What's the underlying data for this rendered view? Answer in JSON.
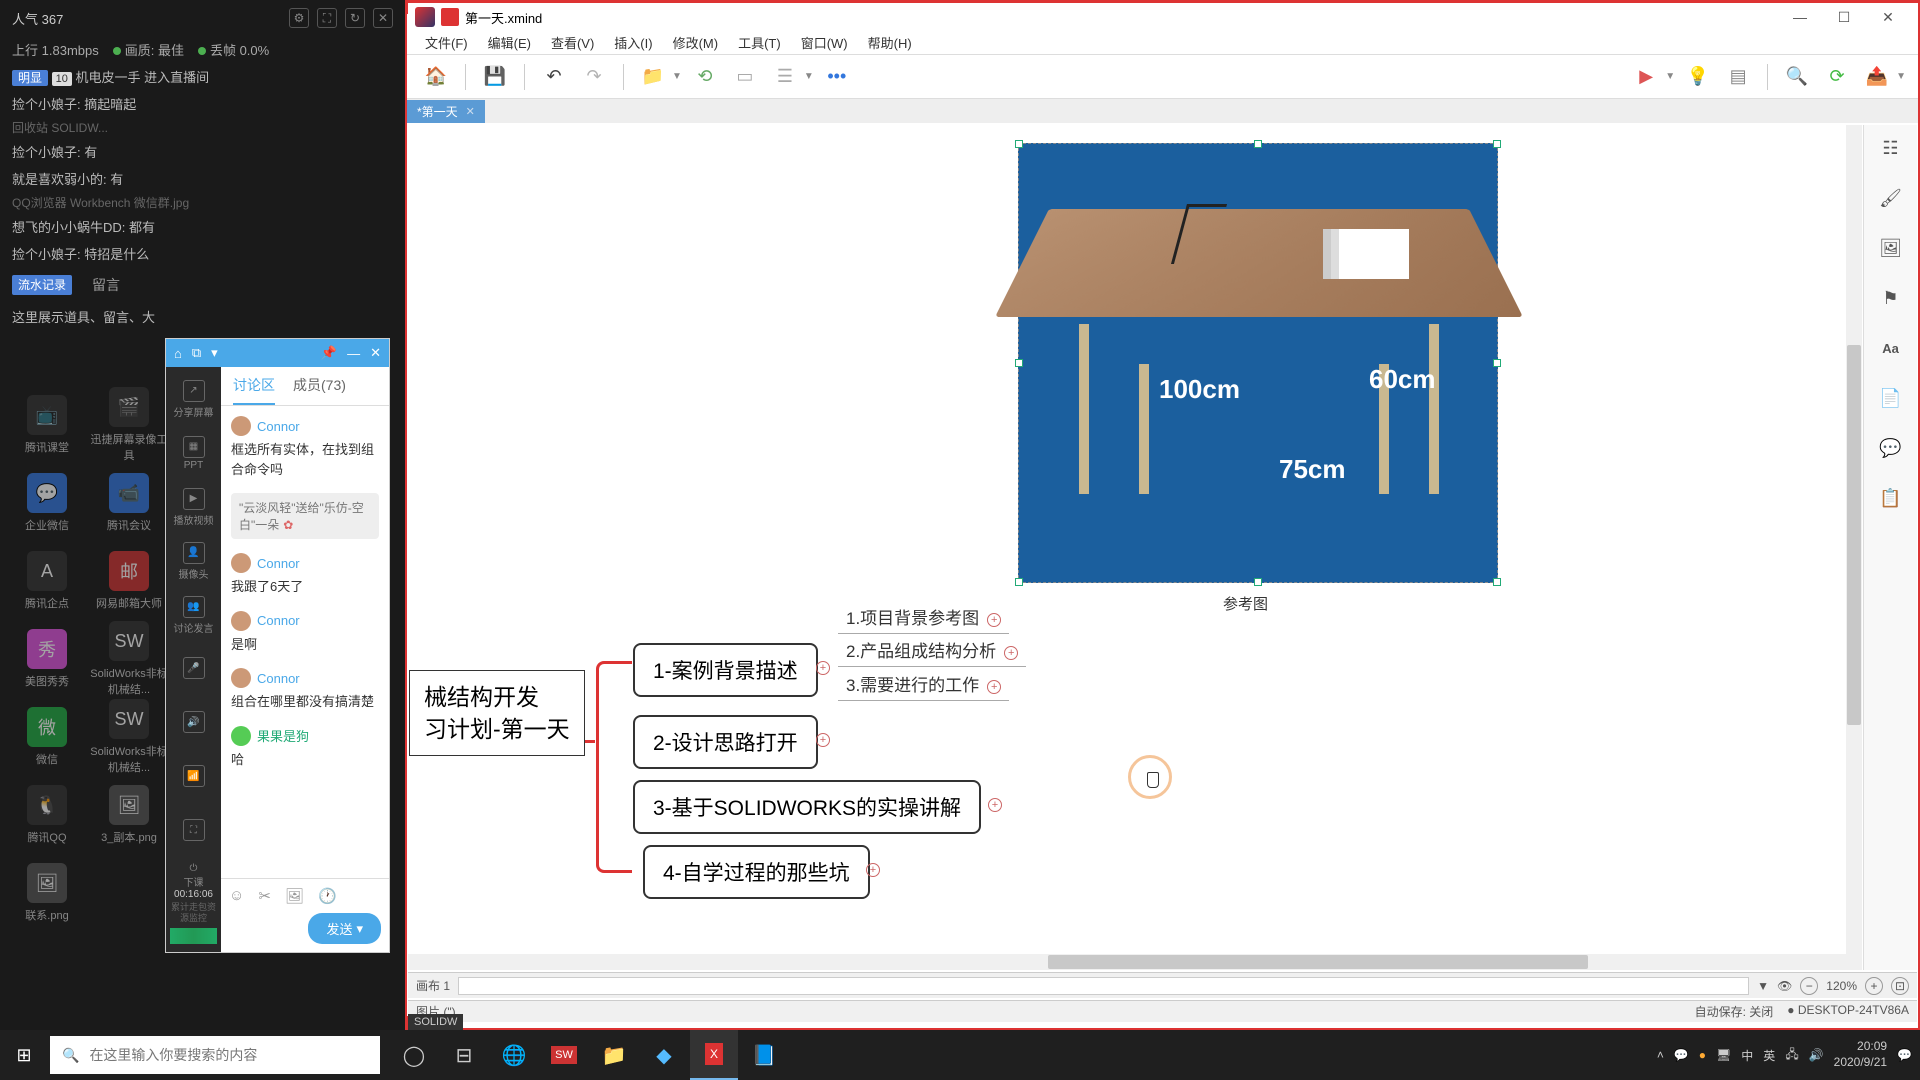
{
  "stream": {
    "pop_label": "人气",
    "pop_val": "367",
    "up_label": "上行",
    "up_val": "1.83mbps",
    "quality": "画质: 最佳",
    "drop": "丢帧 0.0%",
    "badge": "明显",
    "badge_n": "10",
    "title_line": "机电皮一手 进入直播间",
    "c1": "捡个小娘子: 摘起暗起",
    "c1s": "回收站   SOLIDW...",
    "c2": "捡个小娘子: 有",
    "c3": "就是喜欢弱小的: 有",
    "c3s": "QQ浏览器  Workbench  微信群.jpg",
    "c4": "想飞的小小蜗牛DD: 都有",
    "c5": "捡个小娘子: 特招是什么",
    "flow": "流水记录",
    "leave": "留言",
    "c6": "这里展示道具、留言、大"
  },
  "desktop": [
    {
      "l": "腾讯课堂"
    },
    {
      "l": "迅捷屏幕录像工具"
    },
    {
      "l": "企业微信"
    },
    {
      "l": "腾讯会议"
    },
    {
      "l": "腾讯企点"
    },
    {
      "l": "网易邮箱大师"
    },
    {
      "l": "美图秀秀"
    },
    {
      "l": "SolidWorks非标机械结..."
    },
    {
      "l": "微信"
    },
    {
      "l": "SolidWorks非标机械结..."
    },
    {
      "l": "腾讯QQ"
    },
    {
      "l": "3_副本.png"
    },
    {
      "l": "联系.png"
    }
  ],
  "chat": {
    "share": "分享屏幕",
    "ppt": "PPT",
    "play": "播放视频",
    "cam": "摄像头",
    "group": "讨论发言",
    "timer_l": "下课",
    "timer": "00:16:06",
    "timer2": "累计走包资源监控",
    "tab1": "讨论区",
    "tab2": "成员(73)",
    "m1_name": "Connor",
    "m1_txt": "框选所有实体，在找到组合命令吗",
    "sys": "\"云淡风轻\"送给\"乐仿-空白\"一朵",
    "m2_name": "Connor",
    "m2_txt": "我跟了6天了",
    "m3_name": "Connor",
    "m3_txt": "是啊",
    "m4_name": "Connor",
    "m4_txt": "组合在哪里都没有搞清楚",
    "m5_name": "果果是狗",
    "m5_txt": "哈",
    "send": "发送"
  },
  "xmind": {
    "title": "第一天.xmind",
    "menu": [
      "文件(F)",
      "编辑(E)",
      "查看(V)",
      "插入(I)",
      "修改(M)",
      "工具(T)",
      "窗口(W)",
      "帮助(H)"
    ],
    "tab": "*第一天",
    "root_l1": "械结构开发",
    "root_l2": "习计划-第一天",
    "n1": "1-案例背景描述",
    "n2": "2-设计思路打开",
    "n3": "3-基于SOLIDWORKS的实操讲解",
    "n4": "4-自学过程的那些坑",
    "s1": "1.项目背景参考图",
    "s2": "2.产品组成结构分析",
    "s3": "3.需要进行的工作",
    "img_label": "参考图",
    "dim_w": "100cm",
    "dim_d": "60cm",
    "dim_h": "75cm",
    "sheet": "画布 1",
    "sheet_input": "",
    "zoom": "120%",
    "bottom_l": "图片 (\")",
    "autosave": "自动保存: 关闭",
    "host": "DESKTOP-24TV86A"
  },
  "taskbar": {
    "search_ph": "在这里输入你要搜索的内容",
    "ime1": "中",
    "ime2": "英",
    "time": "20:09",
    "date": "2020/9/21"
  },
  "solidw": "SOLIDW"
}
